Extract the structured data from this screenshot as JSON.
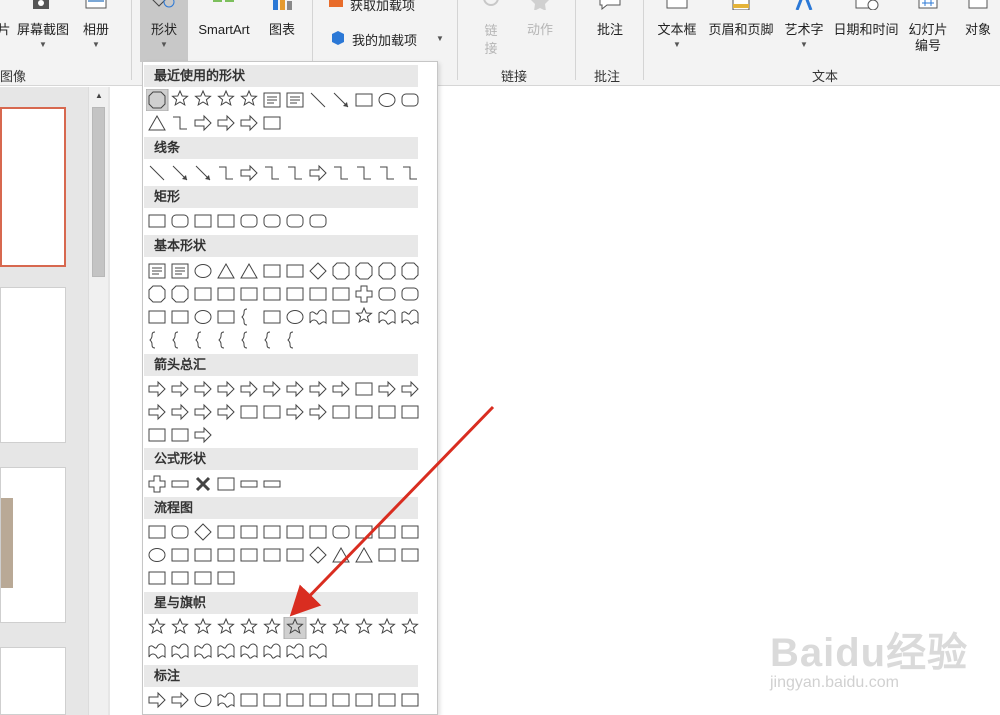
{
  "ribbon": {
    "buttons": [
      {
        "label": "片",
        "icon": "picture-icon"
      },
      {
        "label": "屏幕截图",
        "icon": "camera-icon"
      },
      {
        "label": "相册",
        "icon": "photo-album-icon"
      },
      {
        "label": "形状",
        "icon": "shapes-icon"
      },
      {
        "label": "SmartArt",
        "icon": "smartart-icon"
      },
      {
        "label": "图表",
        "icon": "chart-icon"
      },
      {
        "label": "获取加载项",
        "icon": "store-icon"
      },
      {
        "label": "我的加载项",
        "icon": "addins-icon"
      },
      {
        "label": "链接",
        "icon": "link-icon"
      },
      {
        "label": "动作",
        "icon": "action-icon"
      },
      {
        "label": "批注",
        "icon": "comment-icon"
      },
      {
        "label": "文本框",
        "icon": "textbox-icon"
      },
      {
        "label": "页眉和页脚",
        "icon": "header-footer-icon"
      },
      {
        "label": "艺术字",
        "icon": "wordart-icon"
      },
      {
        "label": "日期和时间",
        "icon": "date-time-icon"
      },
      {
        "label": "幻灯片编号",
        "icon": "slide-number-icon"
      },
      {
        "label": "对象",
        "icon": "object-icon"
      }
    ],
    "groups": {
      "images": "图像",
      "links": "链接",
      "comments": "批注",
      "text": "文本"
    }
  },
  "shapes_menu": {
    "sections": [
      {
        "title": "最近使用的形状",
        "rows": [
          [
            "octagon-8",
            "star6",
            "star5",
            "star",
            "star4",
            "textbox",
            "textbox-v",
            "line",
            "line-arrow",
            "rect",
            "oval",
            "rounded-rect"
          ],
          [
            "triangle",
            "elbow",
            "elbow-arrow",
            "right-arrow",
            "down-arrow",
            "snip-rect"
          ]
        ]
      },
      {
        "title": "线条",
        "rows": [
          [
            "line",
            "line-arrow",
            "line-double-arrow",
            "elbow",
            "elbow-arrow",
            "elbow-double",
            "curve",
            "curve-arrow",
            "curve-double",
            "curve-free",
            "freeform",
            "scribble"
          ]
        ]
      },
      {
        "title": "矩形",
        "rows": [
          [
            "rect",
            "rounded-rect",
            "snip1",
            "snip2",
            "snip-round",
            "round1",
            "round2",
            "rounded-rect"
          ]
        ]
      },
      {
        "title": "基本形状",
        "rows": [
          [
            "textbox",
            "textbox-v",
            "oval",
            "triangle",
            "right-triangle",
            "parallelogram",
            "trapezoid",
            "diamond",
            "pentagon",
            "hexagon",
            "heptagon",
            "octagon-8"
          ],
          [
            "decagon",
            "dodecagon",
            "pie",
            "chord",
            "teardrop",
            "frame",
            "half-frame",
            "l-shape",
            "diag-stripe",
            "plus",
            "plaque",
            "can"
          ],
          [
            "cube",
            "bevel",
            "donut",
            "no-symbol",
            "block-arc",
            "folded",
            "smiley",
            "heart",
            "lightning",
            "sun",
            "moon",
            "cloud"
          ],
          [
            "arc",
            "bracket-pair",
            "brace-pair",
            "left-bracket",
            "right-bracket",
            "left-brace",
            "right-brace"
          ]
        ]
      },
      {
        "title": "箭头总汇",
        "rows": [
          [
            "right-arrow",
            "left-arrow",
            "up-arrow",
            "down-arrow",
            "lr-arrow",
            "ud-arrow",
            "quad-arrow",
            "lru-arrow",
            "bent-arrow",
            "u-turn",
            "left-up-arrow",
            "bent-up-arrow"
          ],
          [
            "curved-right",
            "curved-left",
            "curved-up",
            "curved-down",
            "striped-right",
            "notched-right",
            "pentagon-arrow",
            "chevron",
            "right-callout",
            "down-callout",
            "left-callout",
            "up-callout"
          ],
          [
            "lr-callout",
            "quad-callout",
            "circular-arrow"
          ]
        ]
      },
      {
        "title": "公式形状",
        "rows": [
          [
            "plus",
            "minus",
            "multiply",
            "divide",
            "equal",
            "not-equal"
          ]
        ]
      },
      {
        "title": "流程图",
        "rows": [
          [
            "fc-process",
            "fc-alt",
            "fc-decision",
            "fc-data",
            "fc-predefined",
            "fc-internal",
            "fc-document",
            "fc-multidoc",
            "fc-terminator",
            "fc-prep",
            "fc-manual-input",
            "fc-manual-op"
          ],
          [
            "fc-connector",
            "fc-offpage",
            "fc-card",
            "fc-tape",
            "fc-summing",
            "fc-or",
            "fc-collate",
            "fc-sort",
            "fc-extract",
            "fc-merge",
            "fc-stored",
            "fc-delay"
          ],
          [
            "fc-seq",
            "fc-disk",
            "fc-direct",
            "fc-display"
          ]
        ]
      },
      {
        "title": "星与旗帜",
        "rows": [
          [
            "explosion1",
            "explosion2",
            "star4",
            "star5",
            "star6",
            "star7",
            "star8",
            "star10",
            "star12",
            "star16",
            "star24",
            "star32"
          ],
          [
            "ribbon-up",
            "ribbon-down",
            "ribbon-curve-up",
            "ribbon-curve-down",
            "scroll-v",
            "scroll-h",
            "wave",
            "double-wave"
          ]
        ]
      },
      {
        "title": "标注",
        "rows": [
          [
            "callout-rect",
            "callout-round",
            "callout-oval",
            "callout-cloud",
            "line-callout1",
            "line-callout2",
            "line-callout3",
            "line-callout4",
            "line-callout5",
            "line-callout6",
            "line-callout7",
            "line-callout8"
          ]
        ]
      }
    ]
  },
  "watermark": {
    "brand": "Baidu经验",
    "url": "jingyan.baidu.com"
  },
  "colors": {
    "accent_selected_slide": "#d7684f",
    "annotation_arrow": "#d92d20"
  }
}
